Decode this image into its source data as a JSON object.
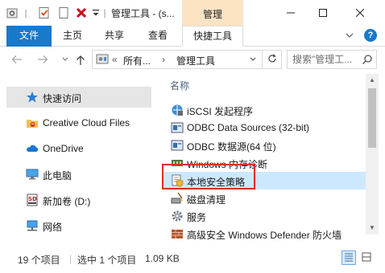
{
  "window": {
    "title": "管理工具 - (s...",
    "context_tab": "管理",
    "accent_color": "#1979ca",
    "context_tab_color": "#fbe3c4"
  },
  "ribbon": {
    "tabs": [
      "文件",
      "主页",
      "共享",
      "查看",
      "快捷工具"
    ],
    "active_tab": "快捷工具"
  },
  "address": {
    "prefix": "所有...",
    "separator": "›",
    "current": "管理工具",
    "search_placeholder": "搜索\"管理工..."
  },
  "nav_pane": {
    "items": [
      {
        "label": "快速访问",
        "icon": "star-icon",
        "selected": true
      },
      {
        "label": "Creative Cloud Files",
        "icon": "creative-cloud-folder-icon"
      },
      {
        "label": "OneDrive",
        "icon": "onedrive-cloud-icon"
      },
      {
        "label": "此电脑",
        "icon": "computer-icon"
      },
      {
        "label": "新加卷 (D:)",
        "icon": "sd-card-drive-icon"
      },
      {
        "label": "网络",
        "icon": "network-icon"
      }
    ]
  },
  "file_list": {
    "column_header": "名称",
    "items": [
      {
        "name": "iSCSI 发起程序",
        "icon": "iscsi-icon"
      },
      {
        "name": "ODBC Data Sources (32-bit)",
        "icon": "odbc-icon"
      },
      {
        "name": "ODBC 数据源(64 位)",
        "icon": "odbc-icon"
      },
      {
        "name": "Windows 内存诊断",
        "icon": "memory-diagnostic-icon"
      },
      {
        "name": "本地安全策略",
        "icon": "security-policy-icon",
        "selected": true
      },
      {
        "name": "磁盘清理",
        "icon": "disk-cleanup-icon"
      },
      {
        "name": "服务",
        "icon": "services-gear-icon"
      },
      {
        "name": "高级安全 Windows Defender 防火墙",
        "icon": "firewall-icon"
      }
    ],
    "highlight_color": "#e02b2b",
    "selection_color": "#cce8ff"
  },
  "status": {
    "item_count": "19 个项目",
    "selection": "选中 1 个项目",
    "size": "1.09 KB"
  }
}
